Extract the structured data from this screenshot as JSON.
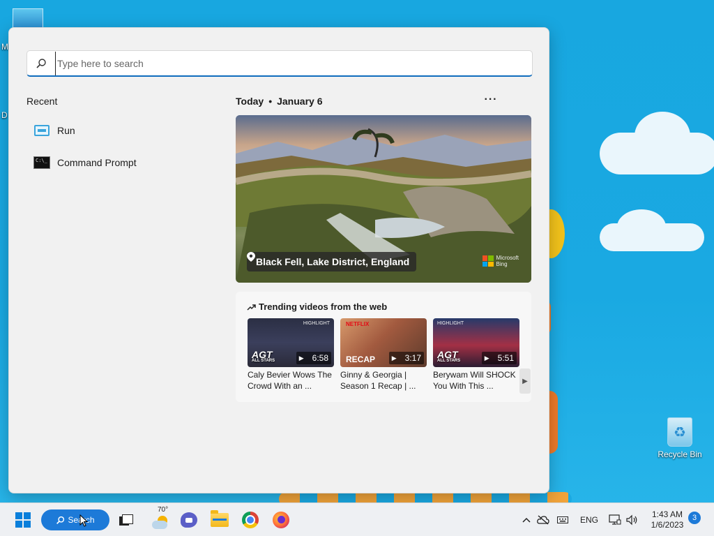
{
  "desktop": {
    "icon_stub_letters": [
      "M",
      "D"
    ],
    "recycle_bin_label": "Recycle Bin"
  },
  "search_panel": {
    "search_placeholder": "Type here to search",
    "search_value": "",
    "recent_title": "Recent",
    "recent_items": [
      {
        "label": "Run",
        "icon": "run-icon"
      },
      {
        "label": "Command Prompt",
        "icon": "command-prompt-icon"
      }
    ],
    "today_label": "Today",
    "date_label": "January 6",
    "more_label": "···",
    "hero": {
      "location": "Black Fell, Lake District, England",
      "brand_line1": "Microsoft",
      "brand_line2": "Bing"
    },
    "trending": {
      "title": "Trending videos from the web",
      "videos": [
        {
          "duration": "6:58",
          "caption_line1": "Caly Bevier Wows The",
          "caption_line2": "Crowd With an ...",
          "overlay": "AGT",
          "overlay_sub": "ALL STARS",
          "tag": "HIGHLIGHT"
        },
        {
          "duration": "3:17",
          "caption_line1": "Ginny & Georgia |",
          "caption_line2": "Season 1 Recap | ...",
          "overlay": "RECAP",
          "tag": "NETFLIX"
        },
        {
          "duration": "5:51",
          "caption_line1": "Berywam Will SHOCK",
          "caption_line2": "You With This ...",
          "overlay": "AGT",
          "overlay_sub": "ALL STARS",
          "tag": "HIGHLIGHT"
        }
      ]
    }
  },
  "taskbar": {
    "search_label": "Search",
    "weather_temp": "70°",
    "language": "ENG",
    "time": "1:43 AM",
    "date": "1/6/2023",
    "notification_count": "3"
  },
  "colors": {
    "accent": "#0f6cbd",
    "taskbar_search": "#1d7ad8",
    "desktop_bg": "#18a7e0"
  }
}
